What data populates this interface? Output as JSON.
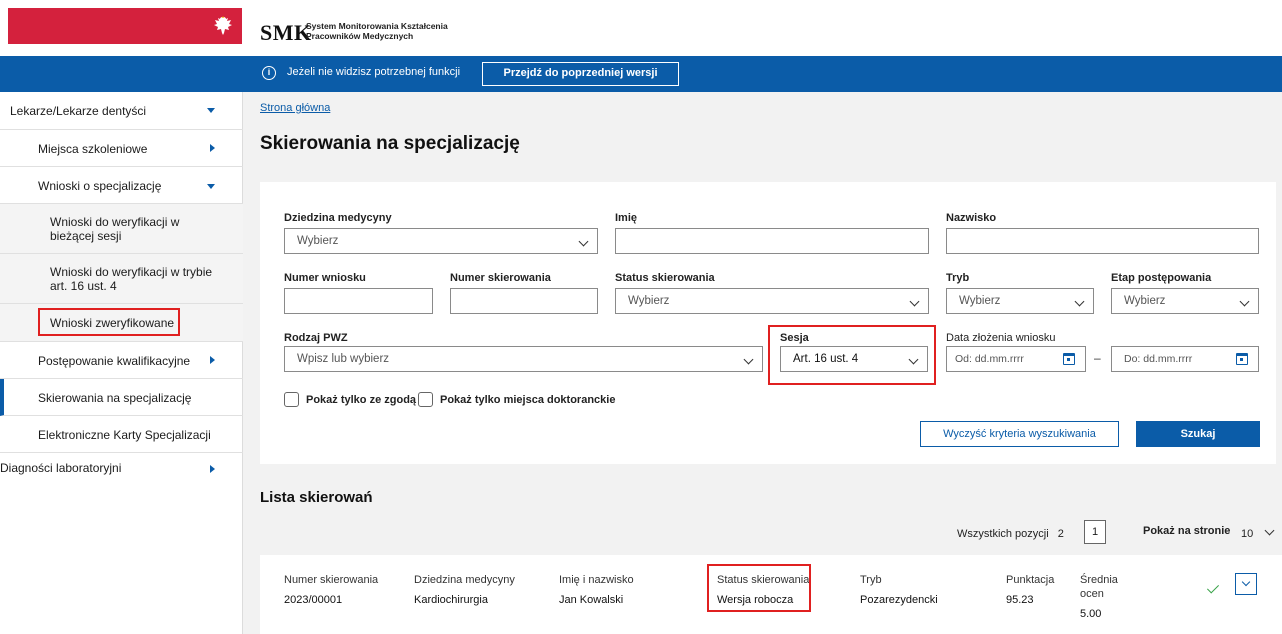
{
  "header": {
    "logo": "SMK",
    "subtitle_line1": "System Monitorowania Kształcenia",
    "subtitle_line2": "Pracowników Medycznych"
  },
  "infobar": {
    "text": "Jeżeli nie widzisz potrzebnej funkcji",
    "button": "Przejdź do poprzedniej wersji"
  },
  "sidebar": {
    "items": [
      {
        "label": "Lekarze/Lekarze dentyści"
      },
      {
        "label": "Miejsca szkoleniowe"
      },
      {
        "label": "Wnioski o specjalizację"
      },
      {
        "label": "Wnioski do weryfikacji w bieżącej sesji"
      },
      {
        "label": "Wnioski do weryfikacji w trybie art. 16 ust. 4"
      },
      {
        "label": "Wnioski zweryfikowane"
      },
      {
        "label": "Postępowanie kwalifikacyjne"
      },
      {
        "label": "Skierowania na specjalizację"
      },
      {
        "label": "Elektroniczne Karty Specjalizacji"
      },
      {
        "label": "Diagności laboratoryjni"
      }
    ]
  },
  "main": {
    "breadcrumb": "Strona główna",
    "title": "Skierowania na specjalizację",
    "filters": {
      "dziedzina_label": "Dziedzina medycyny",
      "dziedzina_value": "Wybierz",
      "imie_label": "Imię",
      "nazwisko_label": "Nazwisko",
      "numer_wniosku_label": "Numer wniosku",
      "numer_skierowania_label": "Numer skierowania",
      "status_label": "Status skierowania",
      "status_value": "Wybierz",
      "tryb_label": "Tryb",
      "tryb_value": "Wybierz",
      "etap_label": "Etap postępowania",
      "etap_value": "Wybierz",
      "pwz_label": "Rodzaj PWZ",
      "pwz_placeholder": "Wpisz lub wybierz",
      "sesja_label": "Sesja",
      "sesja_value": "Art. 16 ust. 4",
      "data_label": "Data złożenia wniosku",
      "data_od": "Od: dd.mm.rrrr",
      "data_do": "Do: dd.mm.rrrr",
      "data_separator": "–",
      "zgoda_label": "Pokaż tylko ze zgodą",
      "doktoranckie_label": "Pokaż tylko miejsca doktoranckie",
      "clear_button": "Wyczyść kryteria wyszukiwania",
      "search_button": "Szukaj"
    },
    "list": {
      "title": "Lista skierowań",
      "total_label": "Wszystkich pozycji",
      "total_value": "2",
      "page": "1",
      "per_page_label": "Pokaż na stronie",
      "per_page_value": "10",
      "columns": {
        "numer": "Numer skierowania",
        "dziedzina": "Dziedzina medycyny",
        "imie": "Imię i nazwisko",
        "status": "Status skierowania",
        "tryb": "Tryb",
        "punktacja": "Punktacja",
        "srednia_line1": "Średnia",
        "srednia_line2": "ocen"
      },
      "rows": [
        {
          "numer": "2023/00001",
          "dziedzina": "Kardiochirurgia",
          "imie": "Jan Kowalski",
          "status": "Wersja robocza",
          "tryb": "Pozarezydencki",
          "punktacja": "95.23",
          "srednia": "5.00"
        }
      ]
    }
  }
}
